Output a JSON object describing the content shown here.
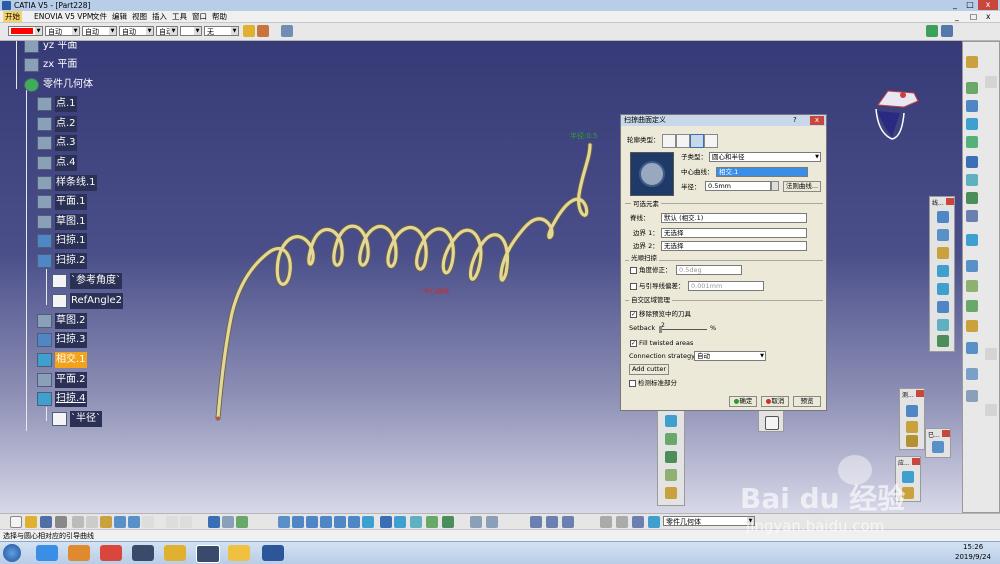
{
  "window": {
    "title": "CATIA V5 - [Part228]",
    "controls": [
      "_",
      "□",
      "x"
    ]
  },
  "menu": [
    "开始",
    "ENOVIA V5 VPM",
    "文件",
    "编辑",
    "视图",
    "插入",
    "工具",
    "窗口",
    "帮助"
  ],
  "toolbar": {
    "color": "#ff0000",
    "combos": [
      "自动",
      "自动",
      "自动",
      "自动",
      "无"
    ]
  },
  "tree": [
    {
      "label": "yz 平面",
      "style": "normal"
    },
    {
      "label": "zx 平面",
      "style": "normal"
    },
    {
      "label": "零件几何体",
      "style": "normal"
    },
    {
      "label": "点.1",
      "style": "dark"
    },
    {
      "label": "点.2",
      "style": "dark"
    },
    {
      "label": "点.3",
      "style": "dark"
    },
    {
      "label": "点.4",
      "style": "dark"
    },
    {
      "label": "样条线.1",
      "style": "dark"
    },
    {
      "label": "平面.1",
      "style": "dark"
    },
    {
      "label": "草图.1",
      "style": "dark"
    },
    {
      "label": "扫掠.1",
      "style": "dark"
    },
    {
      "label": "扫掠.2",
      "style": "dark"
    },
    {
      "label": "`参考角度`",
      "style": "dark"
    },
    {
      "label": "RefAngle2",
      "style": "dark"
    },
    {
      "label": "草图.2",
      "style": "dark"
    },
    {
      "label": "扫掠.3",
      "style": "dark"
    },
    {
      "label": "相交.1",
      "style": "highlight"
    },
    {
      "label": "平面.2",
      "style": "dark"
    },
    {
      "label": "扫掠.4",
      "style": "dark"
    },
    {
      "label": "`半径`",
      "style": "dark"
    }
  ],
  "viewport": {
    "label_radius": "半径:0.5",
    "label_center": "中心曲线"
  },
  "dialog": {
    "title": "扫掠曲面定义",
    "close": "x",
    "help": "?",
    "profile_type_label": "轮廓类型：",
    "subtype_label": "子类型：",
    "subtype_value": "圆心和半径",
    "center_curve_label": "中心曲线：",
    "center_curve_value": "相交.1",
    "radius_label": "半径：",
    "radius_value": "0.5mm",
    "law_button": "法则曲线...",
    "optional_section": "可选元素",
    "spine_label": "脊线：",
    "spine_value": "默认 (相交.1)",
    "border1_label": "边界 1：",
    "border1_value": "无选择",
    "border2_label": "边界 2：",
    "border2_value": "无选择",
    "smooth_section": "光顺扫掠",
    "angle_label": "角度修正：",
    "angle_value": "0.5deg",
    "deviation_label": "与引导线偏差：",
    "deviation_value": "0.001mm",
    "self_intersect_section": "自交区域管理",
    "remove_preview_label": "移除预览中的刀具",
    "setback_label": "Setback",
    "setback_value": "2",
    "setback_unit": "%",
    "fill_twisted_label": "Fill twisted areas",
    "connection_label": "Connection strategy:",
    "connection_value": "自动",
    "add_cutter": "Add cutter",
    "canonical_label": "检测标准部分",
    "ok": "确定",
    "cancel": "取消",
    "preview": "预览"
  },
  "bottom_toolbar": {
    "combo_value": "零件几何体"
  },
  "status": {
    "text": "选择与圆心相对应的引导曲线"
  },
  "clock": {
    "time": "15:26",
    "date": "2019/9/24"
  },
  "watermark": {
    "brand": "Bai du 经验",
    "url": "jingyan.baidu.com"
  },
  "right_panel_labels": {
    "p1": "线...",
    "p2": "测...",
    "p3": "已...",
    "p4": "应..."
  }
}
